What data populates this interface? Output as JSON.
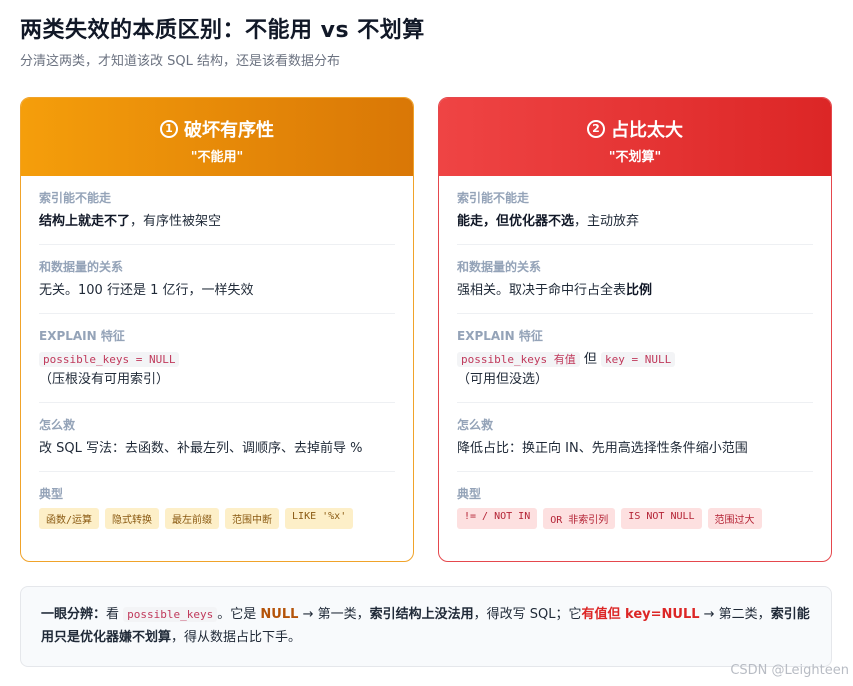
{
  "header": {
    "title": "两类失效的本质区别：不能用 vs 不划算",
    "subtitle": "分清这两类，才知道该改 SQL 结构，还是该看数据分布"
  },
  "card_a": {
    "num": "1",
    "title": "破坏有序性",
    "subtitle": "\"不能用\"",
    "s1_label": "索引能不能走",
    "s1_bold": "结构上就走不了",
    "s1_rest": "，有序性被架空",
    "s2_label": "和数据量的关系",
    "s2_text": "无关。100 行还是 1 亿行，一样失效",
    "s3_label": "EXPLAIN 特征",
    "s3_code": "possible_keys = NULL",
    "s3_note": "（压根没有可用索引）",
    "s4_label": "怎么救",
    "s4_text": "改 SQL 写法：去函数、补最左列、调顺序、去掉前导 %",
    "s5_label": "典型",
    "tags": [
      "函数/运算",
      "隐式转换",
      "最左前缀",
      "范围中断",
      "LIKE '%x'"
    ]
  },
  "card_b": {
    "num": "2",
    "title": "占比太大",
    "subtitle": "\"不划算\"",
    "s1_label": "索引能不能走",
    "s1_bold": "能走，但优化器不选",
    "s1_rest": "，主动放弃",
    "s2_label": "和数据量的关系",
    "s2_text": "强相关。取决于命中行占全表",
    "s2_bold": "比例",
    "s3_label": "EXPLAIN 特征",
    "s3_code1": "possible_keys",
    "s3_red": "有值",
    "s3_mid": "但",
    "s3_code2": "key = NULL",
    "s3_note": "（可用但没选）",
    "s4_label": "怎么救",
    "s4_text": "降低占比：换正向 IN、先用高选择性条件缩小范围",
    "s5_label": "典型",
    "tags": [
      "!= / NOT IN",
      "OR 非索引列",
      "IS NOT NULL",
      "范围过大"
    ]
  },
  "note": {
    "lead": "一眼分辨：",
    "t1": "看",
    "code": "possible_keys",
    "t2": "。它是",
    "null1": "NULL",
    "t3": "→ 第一类，",
    "b1": "索引结构上没法用",
    "t4": "，得改写 SQL；它",
    "red1": "有值但 key=NULL",
    "t5": "→ 第二类，",
    "b2": "索引能用只是优化器嫌不划算",
    "t6": "，得从数据占比下手。"
  },
  "watermark": "CSDN @Leighteen",
  "colors": {
    "card_a_accent": "#f59e0b",
    "card_b_accent": "#ef4444"
  }
}
